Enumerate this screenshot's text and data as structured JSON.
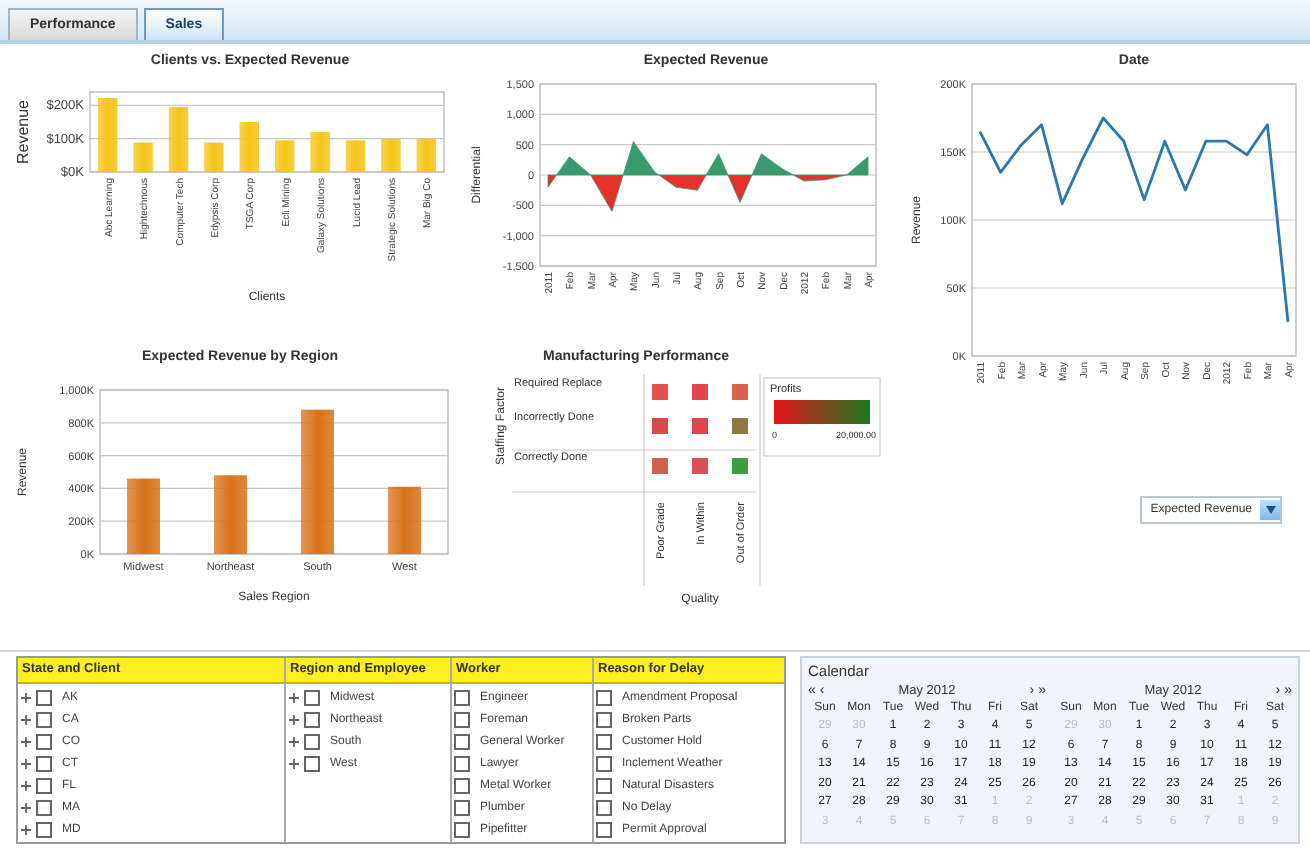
{
  "tabs": [
    {
      "label": "Performance",
      "selected": false
    },
    {
      "label": "Sales",
      "selected": true
    }
  ],
  "clients_chart": {
    "chart_data": {
      "type": "bar",
      "title": "Clients vs. Expected Revenue",
      "xlabel": "Clients",
      "ylabel": "Revenue",
      "categories": [
        "Abc Learning",
        "Hightechnous",
        "Computer Tech",
        "Edypsis Corp",
        "TSGA Corp",
        "Ecli Mining",
        "Galaxy Solutions",
        "Lucid Lead",
        "Strategic Solutions",
        "Mar Big Co"
      ],
      "series": [
        {
          "color": "#f5c518",
          "values": [
            222000,
            88000,
            195000,
            88000,
            150000,
            95000,
            120000,
            95000,
            100000,
            100000
          ]
        }
      ],
      "grid": true,
      "ylim": [
        0,
        240000
      ],
      "yticks": [
        {
          "value": 0,
          "label": "$0K"
        },
        {
          "value": 100000,
          "label": "$100K"
        },
        {
          "value": 200000,
          "label": "$200K"
        }
      ]
    }
  },
  "differential_chart": {
    "chart_data": {
      "type": "area",
      "title": "Expected Revenue",
      "ylabel": "Differential",
      "categories": [
        "2011",
        "Feb",
        "Mar",
        "Apr",
        "May",
        "Jun",
        "Jul",
        "Aug",
        "Sep",
        "Oct",
        "Nov",
        "Dec",
        "2012",
        "Feb",
        "Mar",
        "Apr"
      ],
      "series": [
        {
          "color": "#3a9a6e",
          "values": [
            -200,
            300,
            0,
            -600,
            550,
            50,
            -200,
            -250,
            350,
            -450,
            350,
            100,
            -100,
            -80,
            0,
            300
          ]
        }
      ],
      "grid": true,
      "ylim": [
        -1500,
        1500
      ],
      "yticks": [
        {
          "value": -1500,
          "label": "-1,500"
        },
        {
          "value": -1000,
          "label": "-1,000"
        },
        {
          "value": -500,
          "label": "-500"
        },
        {
          "value": 0,
          "label": "0"
        },
        {
          "value": 500,
          "label": "500"
        },
        {
          "value": 1000,
          "label": "1,000"
        },
        {
          "value": 1500,
          "label": "1,500"
        }
      ]
    }
  },
  "date_chart": {
    "chart_data": {
      "type": "line",
      "title": "Date",
      "ylabel": "Revenue",
      "categories": [
        "2011",
        "Feb",
        "Mar",
        "Apr",
        "May",
        "Jun",
        "Jul",
        "Aug",
        "Sep",
        "Oct",
        "Nov",
        "Dec",
        "2012",
        "Feb",
        "Mar",
        "Apr"
      ],
      "series": [
        {
          "color": "#2a78ae",
          "values": [
            165000,
            135000,
            155000,
            170000,
            112000,
            145000,
            175000,
            158000,
            115000,
            158000,
            122000,
            158000,
            158000,
            148000,
            170000,
            25000
          ]
        }
      ],
      "grid": true,
      "ylim": [
        0,
        200000
      ],
      "yticks": [
        {
          "value": 0,
          "label": "0K"
        },
        {
          "value": 50000,
          "label": "50K"
        },
        {
          "value": 100000,
          "label": "100K"
        },
        {
          "value": 150000,
          "label": "150K"
        },
        {
          "value": 200000,
          "label": "200K"
        }
      ]
    }
  },
  "region_chart": {
    "chart_data": {
      "type": "bar",
      "title": "Expected Revenue by Region",
      "xlabel": "Sales Region",
      "ylabel": "Revenue",
      "categories": [
        "Midwest",
        "Northeast",
        "South",
        "West"
      ],
      "series": [
        {
          "color": "#d9731a",
          "values": [
            460000,
            480000,
            880000,
            410000
          ]
        }
      ],
      "grid": true,
      "ylim": [
        0,
        1000000
      ],
      "yticks": [
        {
          "value": 0,
          "label": "0K"
        },
        {
          "value": 200000,
          "label": "200K"
        },
        {
          "value": 400000,
          "label": "400K"
        },
        {
          "value": 600000,
          "label": "600K"
        },
        {
          "value": 800000,
          "label": "800K"
        },
        {
          "value": 1000000,
          "label": "1,000K"
        }
      ]
    }
  },
  "heatmap": {
    "title": "Manufacturing Performance",
    "ylabel": "Staffing Factor",
    "xlabel": "Quality",
    "columns": [
      "Poor Grade",
      "In Within",
      "Out of Order"
    ],
    "rows": [
      {
        "label": "Required Replace",
        "cells": [
          {
            "color": "#e0504c"
          },
          {
            "color": "#e5474f"
          },
          {
            "color": "#d8604f"
          }
        ]
      },
      {
        "label": "Incorrectly Done",
        "cells": [
          {
            "color": "#d94a4a"
          },
          {
            "color": "#e2434f"
          },
          {
            "color": "#8c7a42"
          }
        ]
      },
      {
        "label": "Correctly Done",
        "cells": [
          {
            "color": "#d0604f"
          },
          {
            "color": "#d8505c"
          },
          {
            "color": "#3e9e40"
          }
        ]
      }
    ],
    "legend": {
      "title": "Profits",
      "min": "0",
      "max": "20,000.00"
    }
  },
  "measure_dropdown": {
    "value": "Expected Revenue"
  },
  "filters": [
    {
      "header": "State and Client",
      "items": [
        {
          "label": "AK",
          "expandable": true,
          "checked": false
        },
        {
          "label": "CA",
          "expandable": true,
          "checked": false
        },
        {
          "label": "CO",
          "expandable": true,
          "checked": false
        },
        {
          "label": "CT",
          "expandable": true,
          "checked": false
        },
        {
          "label": "FL",
          "expandable": true,
          "checked": false
        },
        {
          "label": "MA",
          "expandable": true,
          "checked": false
        },
        {
          "label": "MD",
          "expandable": true,
          "checked": false
        }
      ]
    },
    {
      "header": "Region and Employee",
      "items": [
        {
          "label": "Midwest",
          "expandable": true,
          "checked": false
        },
        {
          "label": "Northeast",
          "expandable": true,
          "checked": false
        },
        {
          "label": "South",
          "expandable": true,
          "checked": false
        },
        {
          "label": "West",
          "expandable": true,
          "checked": false
        }
      ]
    },
    {
      "header": "Worker",
      "items": [
        {
          "label": "Engineer",
          "expandable": false,
          "checked": false
        },
        {
          "label": "Foreman",
          "expandable": false,
          "checked": false
        },
        {
          "label": "General Worker",
          "expandable": false,
          "checked": false
        },
        {
          "label": "Lawyer",
          "expandable": false,
          "checked": false
        },
        {
          "label": "Metal Worker",
          "expandable": false,
          "checked": false
        },
        {
          "label": "Plumber",
          "expandable": false,
          "checked": false
        },
        {
          "label": "Pipefitter",
          "expandable": false,
          "checked": false
        }
      ]
    },
    {
      "header": "Reason for Delay",
      "items": [
        {
          "label": "Amendment Proposal",
          "expandable": false,
          "checked": false
        },
        {
          "label": "Broken Parts",
          "expandable": false,
          "checked": false
        },
        {
          "label": "Customer Hold",
          "expandable": false,
          "checked": false
        },
        {
          "label": "Inclement Weather",
          "expandable": false,
          "checked": false
        },
        {
          "label": "Natural Disasters",
          "expandable": false,
          "checked": false
        },
        {
          "label": "No Delay",
          "expandable": false,
          "checked": false
        },
        {
          "label": "Permit Approval",
          "expandable": false,
          "checked": false
        }
      ]
    }
  ],
  "calendar": {
    "title": "Calendar",
    "months": [
      {
        "label": "May 2012",
        "nav_left": [
          "«",
          "‹"
        ],
        "nav_right": [
          "›",
          "»"
        ],
        "weekdays": [
          "Sun",
          "Mon",
          "Tue",
          "Wed",
          "Thu",
          "Fri",
          "Sat"
        ],
        "weeks": [
          [
            {
              "day": "29",
              "muted": true
            },
            {
              "day": "30",
              "muted": true
            },
            {
              "day": "1",
              "muted": false
            },
            {
              "day": "2",
              "muted": false
            },
            {
              "day": "3",
              "muted": false
            },
            {
              "day": "4",
              "muted": false
            },
            {
              "day": "5",
              "muted": false
            }
          ],
          [
            {
              "day": "6",
              "muted": false
            },
            {
              "day": "7",
              "muted": false
            },
            {
              "day": "8",
              "muted": false
            },
            {
              "day": "9",
              "muted": false
            },
            {
              "day": "10",
              "muted": false
            },
            {
              "day": "11",
              "muted": false
            },
            {
              "day": "12",
              "muted": false
            }
          ],
          [
            {
              "day": "13",
              "muted": false
            },
            {
              "day": "14",
              "muted": false
            },
            {
              "day": "15",
              "muted": false
            },
            {
              "day": "16",
              "muted": false
            },
            {
              "day": "17",
              "muted": false
            },
            {
              "day": "18",
              "muted": false
            },
            {
              "day": "19",
              "muted": false
            }
          ],
          [
            {
              "day": "20",
              "muted": false
            },
            {
              "day": "21",
              "muted": false
            },
            {
              "day": "22",
              "muted": false
            },
            {
              "day": "23",
              "muted": false
            },
            {
              "day": "24",
              "muted": false
            },
            {
              "day": "25",
              "muted": false
            },
            {
              "day": "26",
              "muted": false
            }
          ],
          [
            {
              "day": "27",
              "muted": false
            },
            {
              "day": "28",
              "muted": false
            },
            {
              "day": "29",
              "muted": false
            },
            {
              "day": "30",
              "muted": false
            },
            {
              "day": "31",
              "muted": false
            },
            {
              "day": "1",
              "muted": true
            },
            {
              "day": "2",
              "muted": true
            }
          ],
          [
            {
              "day": "3",
              "muted": true
            },
            {
              "day": "4",
              "muted": true
            },
            {
              "day": "5",
              "muted": true
            },
            {
              "day": "6",
              "muted": true
            },
            {
              "day": "7",
              "muted": true
            },
            {
              "day": "8",
              "muted": true
            },
            {
              "day": "9",
              "muted": true
            }
          ]
        ]
      },
      {
        "label": "May 2012",
        "nav_right": [
          "›",
          "»"
        ],
        "weekdays": [
          "Sun",
          "Mon",
          "Tue",
          "Wed",
          "Thu",
          "Fri",
          "Sat"
        ],
        "weeks": [
          [
            {
              "day": "29",
              "muted": true
            },
            {
              "day": "30",
              "muted": true
            },
            {
              "day": "1",
              "muted": false
            },
            {
              "day": "2",
              "muted": false
            },
            {
              "day": "3",
              "muted": false
            },
            {
              "day": "4",
              "muted": false
            },
            {
              "day": "5",
              "muted": false
            }
          ],
          [
            {
              "day": "6",
              "muted": false
            },
            {
              "day": "7",
              "muted": false
            },
            {
              "day": "8",
              "muted": false
            },
            {
              "day": "9",
              "muted": false
            },
            {
              "day": "10",
              "muted": false
            },
            {
              "day": "11",
              "muted": false
            },
            {
              "day": "12",
              "muted": false
            }
          ],
          [
            {
              "day": "13",
              "muted": false
            },
            {
              "day": "14",
              "muted": false
            },
            {
              "day": "15",
              "muted": false
            },
            {
              "day": "16",
              "muted": false
            },
            {
              "day": "17",
              "muted": false
            },
            {
              "day": "18",
              "muted": false
            },
            {
              "day": "19",
              "muted": false
            }
          ],
          [
            {
              "day": "20",
              "muted": false
            },
            {
              "day": "21",
              "muted": false
            },
            {
              "day": "22",
              "muted": false
            },
            {
              "day": "23",
              "muted": false
            },
            {
              "day": "24",
              "muted": false
            },
            {
              "day": "25",
              "muted": false
            },
            {
              "day": "26",
              "muted": false
            }
          ],
          [
            {
              "day": "27",
              "muted": false
            },
            {
              "day": "28",
              "muted": false
            },
            {
              "day": "29",
              "muted": false
            },
            {
              "day": "30",
              "muted": false
            },
            {
              "day": "31",
              "muted": false
            },
            {
              "day": "1",
              "muted": true
            },
            {
              "day": "2",
              "muted": true
            }
          ],
          [
            {
              "day": "3",
              "muted": true
            },
            {
              "day": "4",
              "muted": true
            },
            {
              "day": "5",
              "muted": true
            },
            {
              "day": "6",
              "muted": true
            },
            {
              "day": "7",
              "muted": true
            },
            {
              "day": "8",
              "muted": true
            },
            {
              "day": "9",
              "muted": true
            }
          ]
        ]
      }
    ]
  }
}
